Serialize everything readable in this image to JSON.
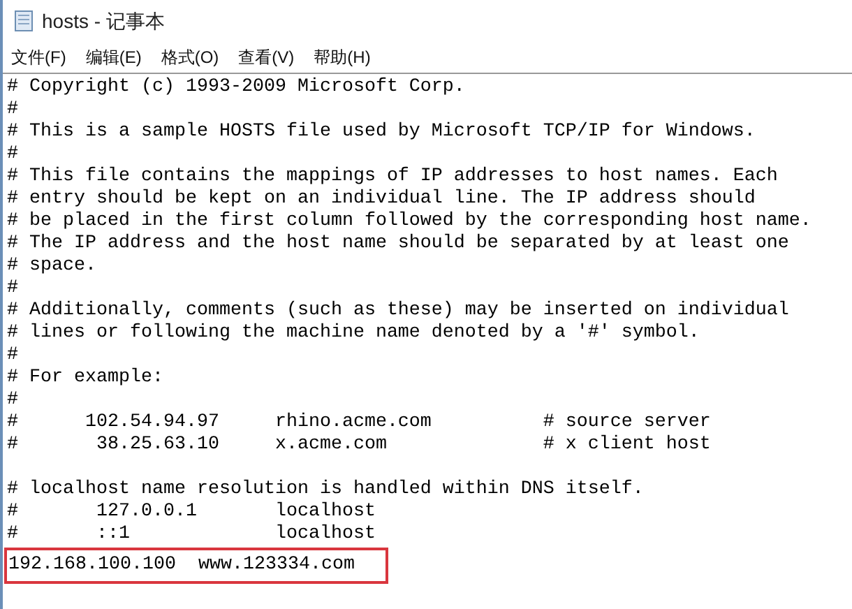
{
  "window": {
    "title": "hosts - 记事本"
  },
  "menu": [
    "文件(F)",
    "编辑(E)",
    "格式(O)",
    "查看(V)",
    "帮助(H)"
  ],
  "lines": [
    {
      "kind": "text",
      "text": "# Copyright (c) 1993-2009 Microsoft Corp.",
      "highlighted": false
    },
    {
      "kind": "text",
      "text": "#",
      "highlighted": false
    },
    {
      "kind": "text",
      "text": "# This is a sample HOSTS file used by Microsoft TCP/IP for Windows.",
      "highlighted": false
    },
    {
      "kind": "text",
      "text": "#",
      "highlighted": false
    },
    {
      "kind": "text",
      "text": "# This file contains the mappings of IP addresses to host names. Each",
      "highlighted": false
    },
    {
      "kind": "text",
      "text": "# entry should be kept on an individual line. The IP address should",
      "highlighted": false
    },
    {
      "kind": "text",
      "text": "# be placed in the first column followed by the corresponding host name.",
      "highlighted": false
    },
    {
      "kind": "text",
      "text": "# The IP address and the host name should be separated by at least one",
      "highlighted": false
    },
    {
      "kind": "text",
      "text": "# space.",
      "highlighted": false
    },
    {
      "kind": "text",
      "text": "#",
      "highlighted": false
    },
    {
      "kind": "text",
      "text": "# Additionally, comments (such as these) may be inserted on individual",
      "highlighted": false
    },
    {
      "kind": "text",
      "text": "# lines or following the machine name denoted by a '#' symbol.",
      "highlighted": false
    },
    {
      "kind": "text",
      "text": "#",
      "highlighted": false
    },
    {
      "kind": "text",
      "text": "# For example:",
      "highlighted": false
    },
    {
      "kind": "text",
      "text": "#",
      "highlighted": false
    },
    {
      "kind": "text",
      "text": "#      102.54.94.97     rhino.acme.com          # source server",
      "highlighted": false
    },
    {
      "kind": "text",
      "text": "#       38.25.63.10     x.acme.com              # x client host",
      "highlighted": false
    },
    {
      "kind": "blank",
      "highlighted": false
    },
    {
      "kind": "text",
      "text": "# localhost name resolution is handled within DNS itself.",
      "highlighted": false
    },
    {
      "kind": "text",
      "text": "#       127.0.0.1       localhost",
      "highlighted": false
    },
    {
      "kind": "text",
      "text": "#       ::1             localhost",
      "highlighted": false
    },
    {
      "kind": "text",
      "text": "192.168.100.100  www.123334.com",
      "highlighted": true
    }
  ]
}
